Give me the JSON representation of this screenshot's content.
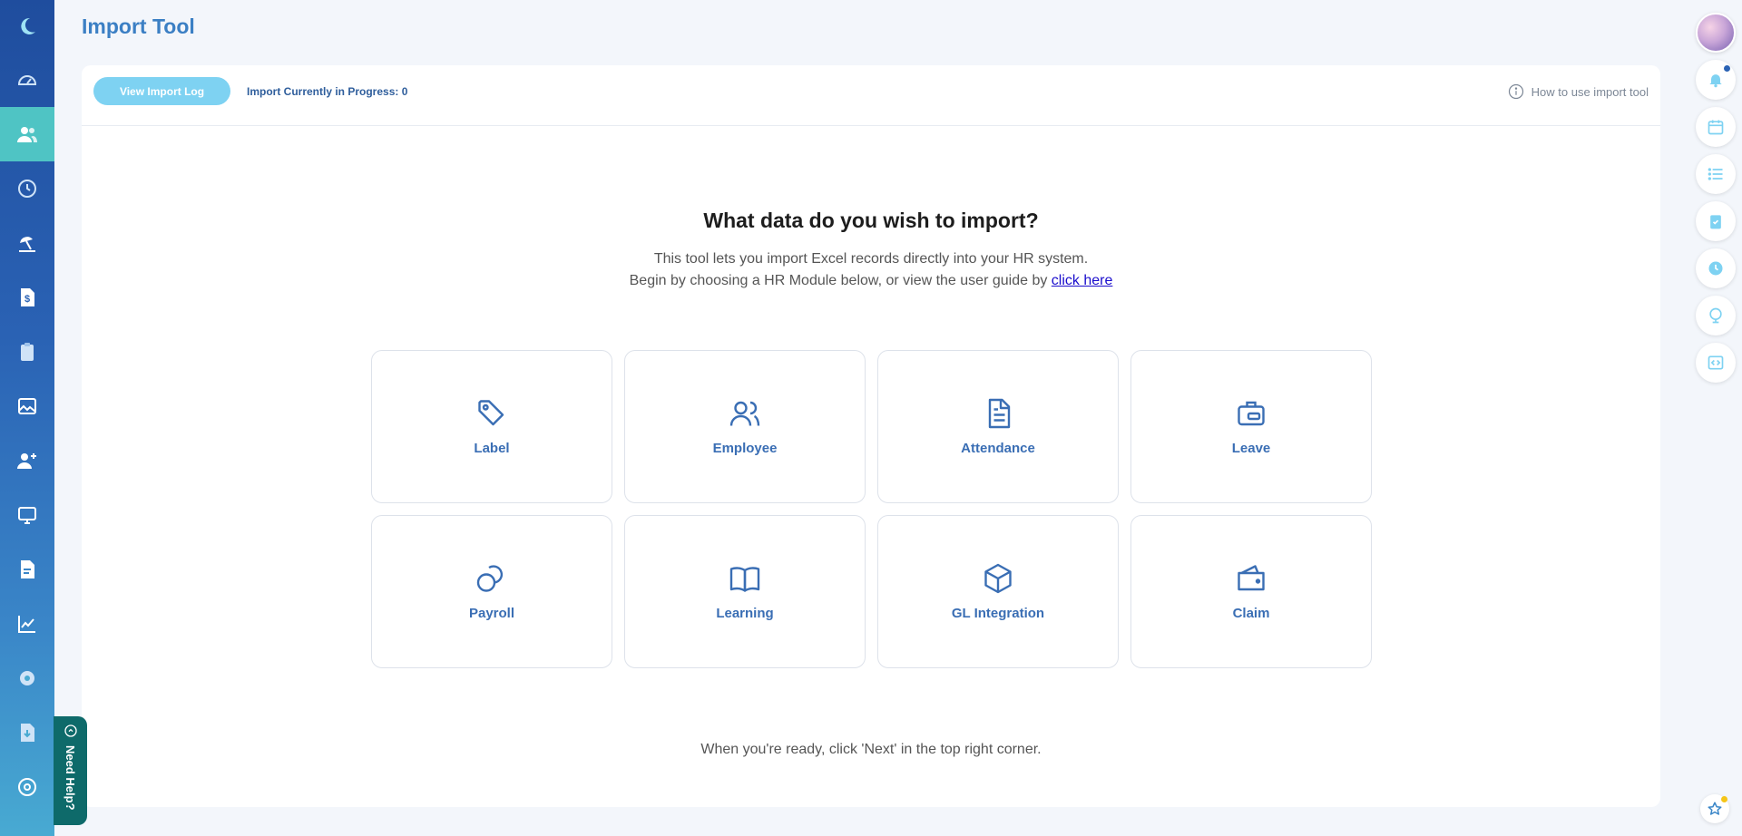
{
  "header": {
    "title": "Import Tool"
  },
  "toolbar": {
    "view_log_label": "View Import Log",
    "progress_text": "Import Currently in Progress: 0",
    "howto_label": "How to use import tool"
  },
  "content": {
    "heading": "What data do you wish to import?",
    "desc_line1": "This tool lets you import Excel records directly into your HR system.",
    "desc_line2": "Begin by choosing a HR Module below, or view the user guide by",
    "desc_link": "click here",
    "footer": "When you're ready, click 'Next' in the top right corner."
  },
  "modules": [
    {
      "label": "Label",
      "icon": "tag-icon"
    },
    {
      "label": "Employee",
      "icon": "users-icon"
    },
    {
      "label": "Attendance",
      "icon": "document-icon"
    },
    {
      "label": "Leave",
      "icon": "briefcase-icon"
    },
    {
      "label": "Payroll",
      "icon": "coins-icon"
    },
    {
      "label": "Learning",
      "icon": "book-icon"
    },
    {
      "label": "GL Integration",
      "icon": "cube-icon"
    },
    {
      "label": "Claim",
      "icon": "wallet-icon"
    }
  ],
  "sidebar": {
    "items": [
      {
        "name": "logo",
        "icon": "moon-icon"
      },
      {
        "name": "dashboard",
        "icon": "speedometer-icon"
      },
      {
        "name": "employees",
        "icon": "users-icon",
        "active": true
      },
      {
        "name": "attendance",
        "icon": "clock-history-icon"
      },
      {
        "name": "leave",
        "icon": "beach-icon"
      },
      {
        "name": "payroll",
        "icon": "dollar-doc-icon"
      },
      {
        "name": "claims",
        "icon": "clipboard-icon"
      },
      {
        "name": "reports-image",
        "icon": "image-icon"
      },
      {
        "name": "recruitment",
        "icon": "user-plus-icon"
      },
      {
        "name": "training",
        "icon": "monitor-icon"
      },
      {
        "name": "documents",
        "icon": "file-icon"
      },
      {
        "name": "analytics",
        "icon": "chart-icon"
      },
      {
        "name": "settings",
        "icon": "gear-icon"
      },
      {
        "name": "import",
        "icon": "download-doc-icon"
      },
      {
        "name": "account",
        "icon": "at-icon"
      }
    ]
  },
  "need_help": {
    "label": "Need Help?"
  },
  "colors": {
    "accent": "#3b7fc4",
    "sidebar_active": "#4fc4c4",
    "button": "#7ed2f2",
    "help_tab": "#0e6a6a"
  }
}
